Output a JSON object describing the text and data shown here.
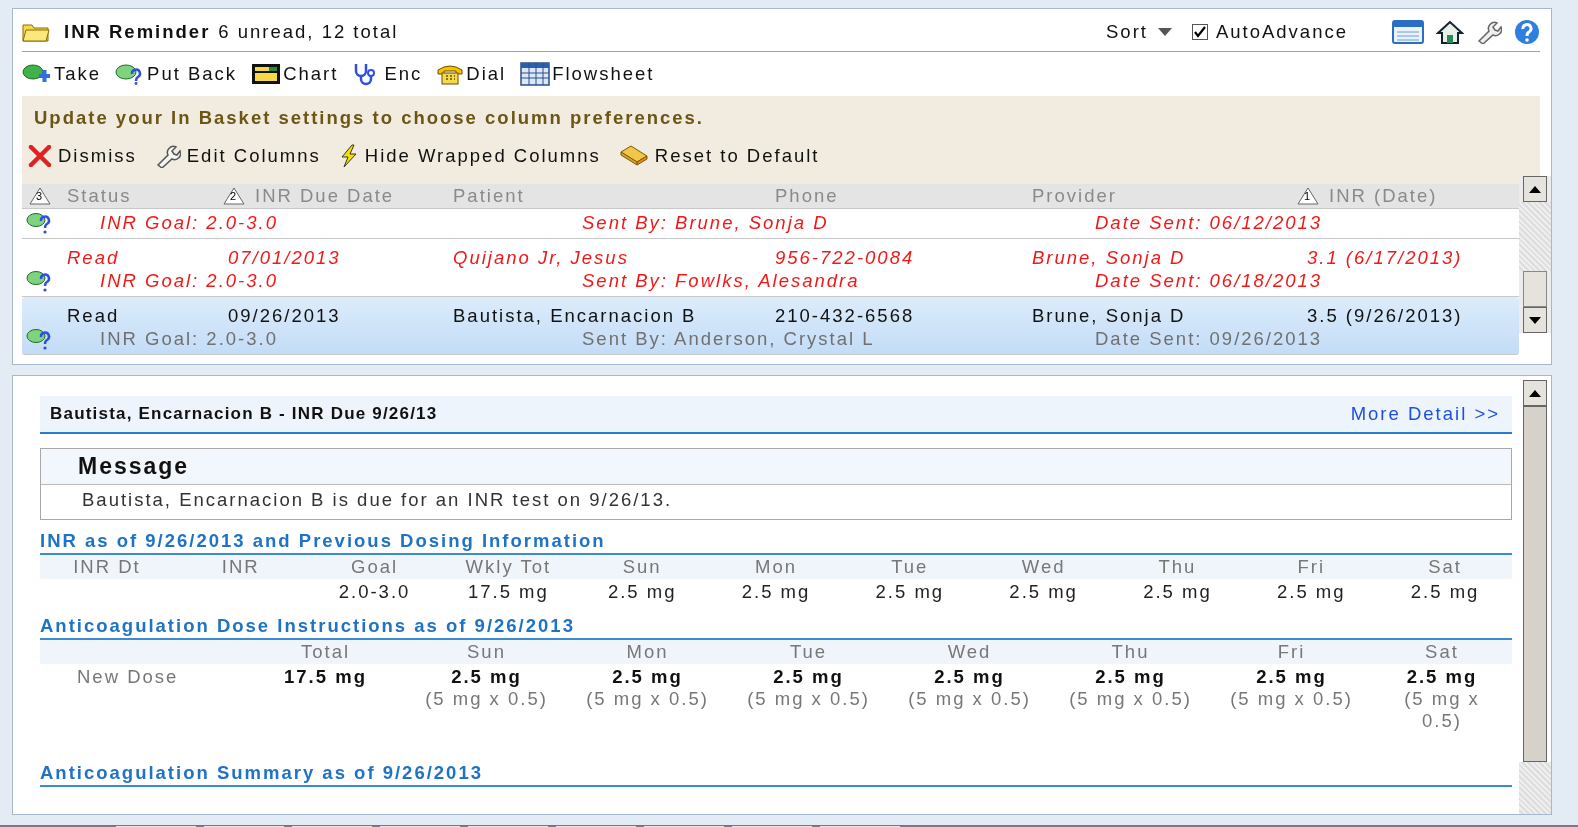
{
  "header": {
    "title": "INR Reminder",
    "summary": "6 unread, 12 total",
    "sort": "Sort",
    "auto_advance": {
      "label": "AutoAdvance",
      "checked": true
    }
  },
  "toolbar": [
    "Take",
    "Put Back",
    "Chart",
    "Enc",
    "Dial",
    "Flowsheet"
  ],
  "notice": {
    "text": "Update your In Basket settings to choose column preferences.",
    "actions": [
      "Dismiss",
      "Edit Columns",
      "Hide Wrapped Columns",
      "Reset to Default"
    ]
  },
  "table": {
    "columns": [
      {
        "label": "Status",
        "sort_rank": "3"
      },
      {
        "label": "INR Due Date",
        "sort_rank": "2"
      },
      {
        "label": "Patient"
      },
      {
        "label": "Phone"
      },
      {
        "label": "Provider"
      },
      {
        "label": "INR (Date)",
        "sort_rank": "1"
      }
    ],
    "rows": [
      {
        "overdue": true,
        "selected": false,
        "goal": "INR Goal: 2.0-3.0",
        "sent_by": "Sent By: Brune, Sonja D",
        "date_sent": "Date Sent: 06/12/2013"
      },
      {
        "overdue": true,
        "selected": false,
        "cells": [
          "Read",
          "07/01/2013",
          "Quijano Jr, Jesus",
          "956-722-0084",
          "Brune, Sonja D",
          "3.1 (6/17/2013)"
        ],
        "goal": "INR Goal: 2.0-3.0",
        "sent_by": "Sent By: Fowlks, Alesandra",
        "date_sent": "Date Sent: 06/18/2013"
      },
      {
        "overdue": false,
        "selected": true,
        "cells": [
          "Read",
          "09/26/2013",
          "Bautista, Encarnacion B",
          "210-432-6568",
          "Brune, Sonja D",
          "3.5 (9/26/2013)"
        ],
        "goal": "INR Goal: 2.0-3.0",
        "sent_by": "Sent By: Anderson, Crystal L",
        "date_sent": "Date Sent: 09/26/2013"
      }
    ]
  },
  "detail": {
    "title": "Bautista, Encarnacion B - INR Due 9/26/13",
    "more_link": "More Detail >>",
    "message": {
      "heading": "Message",
      "body": "Bautista, Encarnacion B is due for an INR test on 9/26/13."
    },
    "inr_section": {
      "title": "INR as of 9/26/2013 and Previous Dosing Information",
      "columns": [
        {
          "header": "INR Dt"
        },
        {
          "header": "INR"
        },
        {
          "header": "Goal",
          "value": "2.0-3.0"
        },
        {
          "header": "Wkly Tot",
          "value": "17.5 mg"
        },
        {
          "header": "Sun",
          "value": "2.5 mg"
        },
        {
          "header": "Mon",
          "value": "2.5 mg"
        },
        {
          "header": "Tue",
          "value": "2.5 mg"
        },
        {
          "header": "Wed",
          "value": "2.5 mg"
        },
        {
          "header": "Thu",
          "value": "2.5 mg"
        },
        {
          "header": "Fri",
          "value": "2.5 mg"
        },
        {
          "header": "Sat",
          "value": "2.5 mg"
        }
      ]
    },
    "dose_section": {
      "title": "Anticoagulation Dose Instructions as of 9/26/2013",
      "row_label": "New Dose",
      "columns": [
        {
          "header": "Total",
          "dose": "17.5 mg"
        },
        {
          "header": "Sun",
          "dose": "2.5 mg",
          "detail": "(5 mg x 0.5)"
        },
        {
          "header": "Mon",
          "dose": "2.5 mg",
          "detail": "(5 mg x 0.5)"
        },
        {
          "header": "Tue",
          "dose": "2.5 mg",
          "detail": "(5 mg x 0.5)"
        },
        {
          "header": "Wed",
          "dose": "2.5 mg",
          "detail": "(5 mg x 0.5)"
        },
        {
          "header": "Thu",
          "dose": "2.5 mg",
          "detail": "(5 mg x 0.5)"
        },
        {
          "header": "Fri",
          "dose": "2.5 mg",
          "detail": "(5 mg x 0.5)"
        },
        {
          "header": "Sat",
          "dose": "2.5 mg",
          "detail": "(5 mg x 0.5)"
        }
      ]
    },
    "summary_section": {
      "title": "Anticoagulation Summary as of 9/26/2013"
    }
  }
}
